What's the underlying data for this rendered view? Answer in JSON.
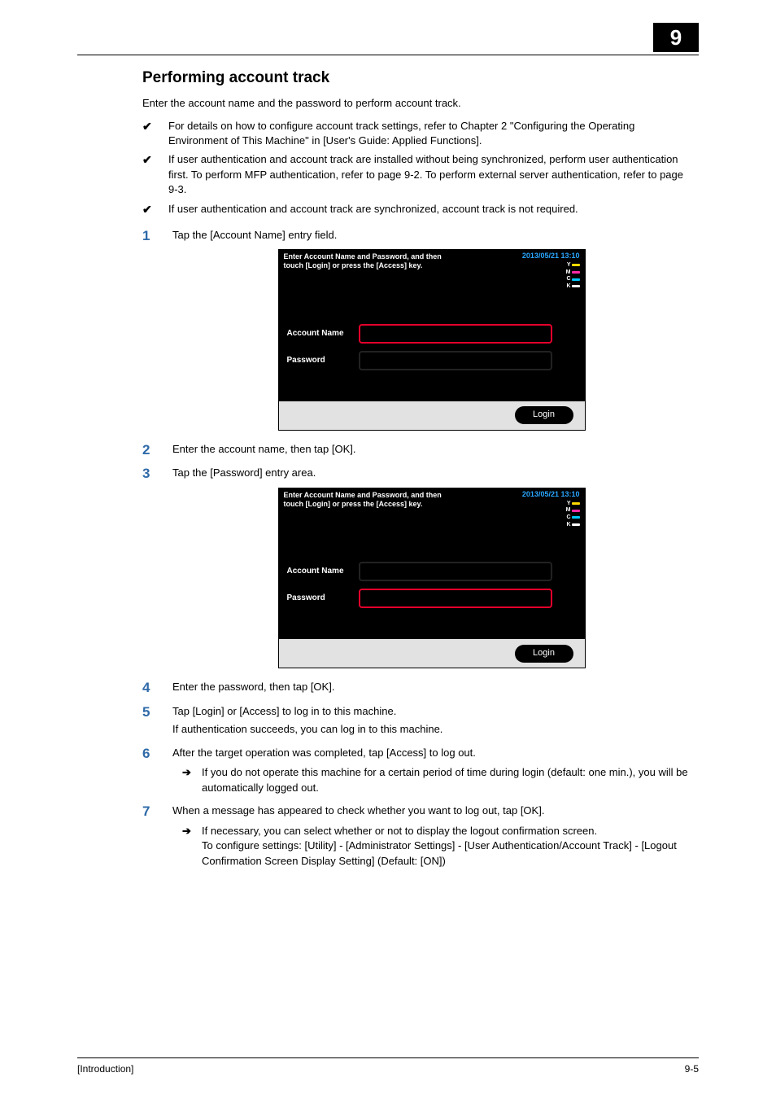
{
  "chapter_number": "9",
  "heading": "Performing account track",
  "intro": "Enter the account name and the password to perform account track.",
  "bullets": [
    "For details on how to configure account track settings, refer to Chapter 2 \"Configuring the Operating Environment of This Machine\" in [User's Guide: Applied Functions].",
    "If user authentication and account track are installed without being synchronized, perform user authentication first. To perform MFP authentication, refer to page 9-2. To perform external server authentication, refer to page 9-3.",
    "If user authentication and account track are synchronized, account track is not required."
  ],
  "steps": {
    "s1": {
      "num": "1",
      "text": "Tap the [Account Name] entry field."
    },
    "s2": {
      "num": "2",
      "text": "Enter the account name, then tap [OK]."
    },
    "s3": {
      "num": "3",
      "text": "Tap the [Password] entry area."
    },
    "s4": {
      "num": "4",
      "text": "Enter the password, then tap [OK]."
    },
    "s5": {
      "num": "5",
      "text": "Tap [Login] or [Access] to log in to this machine.",
      "extra": "If authentication succeeds, you can log in to this machine."
    },
    "s6": {
      "num": "6",
      "text": "After the target operation was completed, tap [Access] to log out.",
      "sub": "If you do not operate this machine for a certain period of time during login (default: one min.), you will be automatically logged out."
    },
    "s7": {
      "num": "7",
      "text": "When a message has appeared to check whether you want to log out, tap [OK].",
      "sub": "If necessary, you can select whether or not to display the logout confirmation screen.\nTo configure settings: [Utility] - [Administrator Settings] - [User Authentication/Account Track] - [Logout Confirmation Screen Display Setting] (Default: [ON])"
    }
  },
  "panel": {
    "instruction_line1": "Enter Account Name and Password, and then",
    "instruction_line2": "touch [Login] or press the [Access] key.",
    "datetime": "2013/05/21 13:10",
    "account_label": "Account Name",
    "password_label": "Password",
    "login_label": "Login",
    "toner": {
      "y": "Y",
      "m": "M",
      "c": "C",
      "k": "K"
    }
  },
  "footer": {
    "left": "[Introduction]",
    "right": "9-5"
  },
  "icons": {
    "check": "✔",
    "arrow": "➔"
  }
}
